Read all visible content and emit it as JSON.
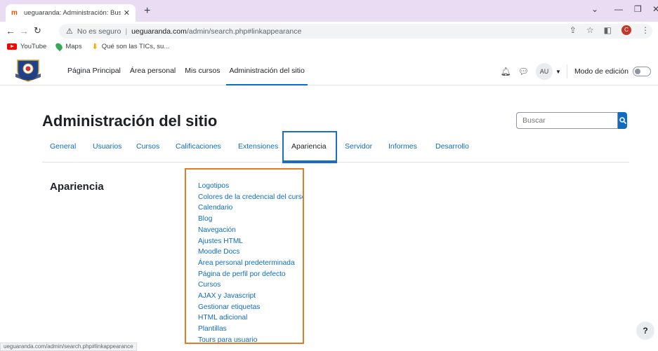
{
  "browser": {
    "tab_title": "ueguaranda: Administración: Bus",
    "tab_favicon": "m",
    "url_warning": "No es seguro",
    "url_host": "ueguaranda.com",
    "url_path": "/admin/search.php#linkappearance",
    "bookmarks": [
      {
        "label": "YouTube",
        "icon": "youtube-icon"
      },
      {
        "label": "Maps",
        "icon": "maps-icon"
      },
      {
        "label": "Qué son las TICs, su...",
        "icon": "download-icon"
      }
    ],
    "profile_initial": "C",
    "status_url": "ueguaranda.com/admin/search.php#linkappearance"
  },
  "navbar": {
    "items": [
      {
        "label": "Página Principal"
      },
      {
        "label": "Área personal"
      },
      {
        "label": "Mis cursos"
      },
      {
        "label": "Administración del sitio"
      }
    ],
    "user_initials": "AU",
    "edit_mode_label": "Modo de edición"
  },
  "page": {
    "title": "Administración del sitio",
    "search_placeholder": "Buscar",
    "tabs": [
      {
        "label": "General"
      },
      {
        "label": "Usuarios"
      },
      {
        "label": "Cursos"
      },
      {
        "label": "Calificaciones"
      },
      {
        "label": "Extensiones"
      },
      {
        "label": "Apariencia"
      },
      {
        "label": "Servidor"
      },
      {
        "label": "Informes"
      },
      {
        "label": "Desarrollo"
      }
    ],
    "section_title": "Apariencia",
    "links": [
      "Logotipos",
      "Colores de la credencial del curso",
      "Calendario",
      "Blog",
      "Navegación",
      "Ajustes HTML",
      "Moodle Docs",
      "Área personal predeterminada",
      "Página de perfil por defecto",
      "Cursos",
      "AJAX y Javascript",
      "Gestionar etiquetas",
      "HTML adicional",
      "Plantillas",
      "Tours para usuario"
    ],
    "help_label": "?"
  },
  "colors": {
    "accent": "#0f6cbf",
    "highlight_box": "#e07b2c",
    "tab_strip": "#e9dcf3"
  }
}
